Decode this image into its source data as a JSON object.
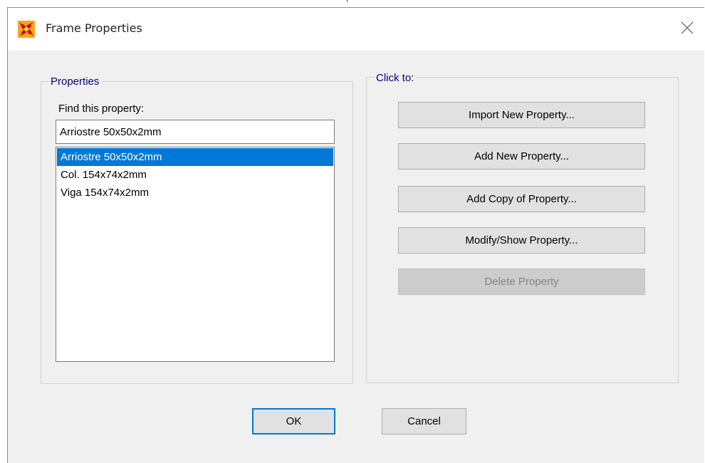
{
  "window": {
    "title": "Frame Properties",
    "app_icon": "sap2000-logo-icon",
    "close_icon": "close-icon"
  },
  "properties_group": {
    "label": "Properties",
    "find_label": "Find this property:",
    "find_value": "Arriostre 50x50x2mm",
    "items": [
      {
        "label": "Arriostre 50x50x2mm",
        "selected": true
      },
      {
        "label": "Col. 154x74x2mm",
        "selected": false
      },
      {
        "label": "Viga 154x74x2mm",
        "selected": false
      }
    ]
  },
  "click_to_group": {
    "label": "Click to:",
    "buttons": {
      "import": "Import New Property...",
      "add_new": "Add New Property...",
      "add_copy": "Add Copy of Property...",
      "modify_show": "Modify/Show Property...",
      "delete": "Delete Property"
    },
    "delete_enabled": false
  },
  "footer": {
    "ok_label": "OK",
    "cancel_label": "Cancel"
  },
  "colors": {
    "selection": "#0078d7",
    "group_label": "#000080",
    "dialog_bg": "#f0f0f0"
  }
}
